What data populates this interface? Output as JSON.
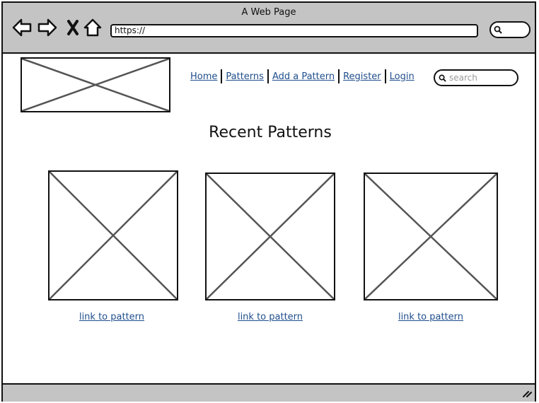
{
  "window": {
    "title": "A Web Page"
  },
  "browser": {
    "url": "https://"
  },
  "header": {
    "nav": [
      "Home",
      "Patterns",
      "Add a Pattern",
      "Register",
      "Login"
    ],
    "search_placeholder": "search"
  },
  "main": {
    "heading": "Recent Patterns",
    "patterns": [
      {
        "link": "link to pattern"
      },
      {
        "link": "link to pattern"
      },
      {
        "link": "link to pattern"
      }
    ]
  },
  "colors": {
    "link": "#1f4e8c",
    "chrome": "#c4c4c4"
  }
}
